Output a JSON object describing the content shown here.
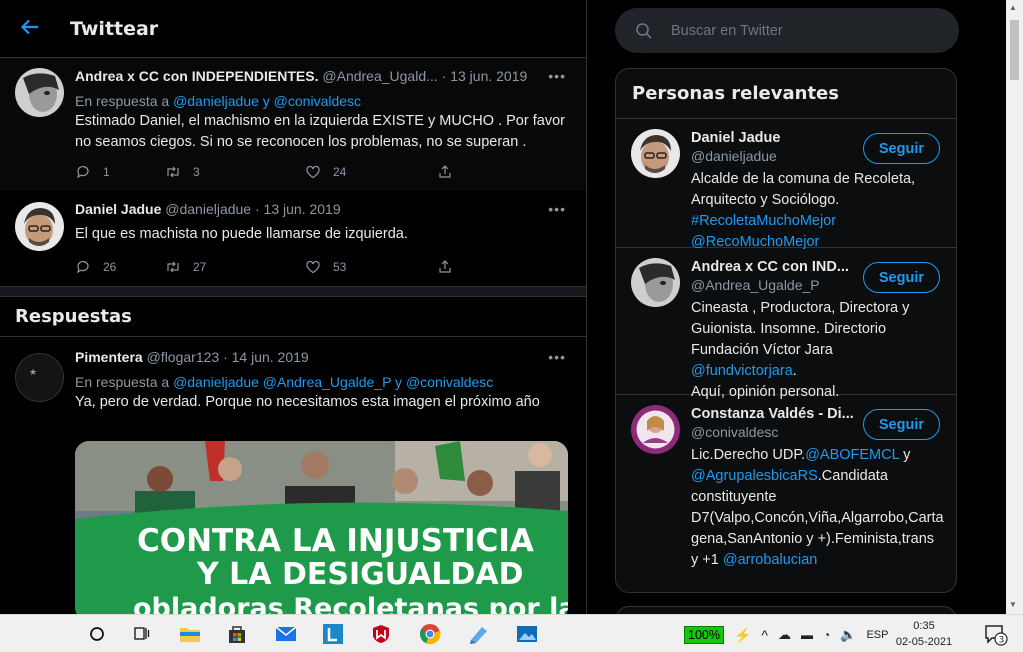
{
  "header": {
    "title": "Twittear",
    "back_icon": "arrow-left-icon"
  },
  "thread": [
    {
      "name": "Andrea x CC con INDEPENDIENTES.",
      "handle": "@Andrea_Ugald...",
      "date": "· 13 jun. 2019",
      "reply_prefix": "En respuesta a",
      "reply_to": "@danieljadue y @conivaldesc",
      "text_lines": [
        "Estimado Daniel, el machismo en la izquierda EXISTE y MUCHO . Por favor",
        "no seamos ciegos. Si no se reconocen los problemas, no se superan ."
      ],
      "replies": "1",
      "retweets": "3",
      "likes": "24"
    },
    {
      "name": "Daniel Jadue",
      "handle": "@danieljadue",
      "date": "· 13 jun. 2019",
      "text_lines": [
        "El que es machista no puede llamarse de izquierda."
      ],
      "replies": "26",
      "retweets": "27",
      "likes": "53"
    }
  ],
  "responses": {
    "heading": "Respuestas",
    "items": [
      {
        "name": "Pimentera",
        "handle": "@flogar123",
        "date": "· 14 jun. 2019",
        "reply_prefix": "En respuesta a",
        "reply_to": "@danieljadue @Andrea_Ugalde_P y @conivaldesc",
        "text": "Ya, pero de verdad. Porque no necesitamos esta imagen el próximo año",
        "media_banner_lines": [
          "CONTRA LA INJUSTICIA",
          "Y LA DESIGUALDAD",
          "obladoras Recoletanas por la vi"
        ]
      }
    ]
  },
  "search": {
    "placeholder": "Buscar en Twitter"
  },
  "relevant_people": {
    "title": "Personas relevantes",
    "follow_label": "Seguir",
    "people": [
      {
        "name": "Daniel Jadue",
        "handle": "@danieljadue",
        "bio_lines": [
          "Alcalde de la comuna de Recoleta,",
          "Arquitecto y Sociólogo."
        ],
        "bio_links": [
          "#RecoletaMuchoMejor",
          "@RecoMuchoMejor"
        ]
      },
      {
        "name": "Andrea x CC con IND...",
        "handle": "@Andrea_Ugalde_P",
        "bio_lines": [
          "Cineasta , Productora, Directora y",
          "Guionista. Insomne. Directorio",
          "Fundación Víctor Jara",
          "Aquí, opinión personal."
        ],
        "bio_link": "@fundvictorjara"
      },
      {
        "name": "Constanza Valdés - Di...",
        "handle": "@conivaldesc",
        "bio_parts": [
          "Lic.Derecho UDP.",
          "@ABOFEMCL",
          " y",
          "@AgrupalesbicaRS",
          ".Candidata",
          "constituyente",
          "D7(Valpo,Concón,Viña,Algarrobo,Carta",
          "gena,SanAntonio y +).Feminista,trans",
          "y +1",
          "@arrobalucian"
        ]
      }
    ]
  },
  "taskbar": {
    "battery": "100%",
    "language": "ESP",
    "time": "0:35",
    "date": "02-05-2021",
    "notifications": "3",
    "pinned_apps": [
      "search-icon",
      "task-view-icon",
      "file-explorer-icon",
      "store-icon",
      "mail-icon",
      "app-l-icon",
      "mcafee-icon",
      "chrome-icon",
      "app-blue-icon",
      "photos-icon"
    ]
  },
  "colors": {
    "accent": "#1d9bf0",
    "background": "#000000",
    "battery": "#16c60c"
  }
}
